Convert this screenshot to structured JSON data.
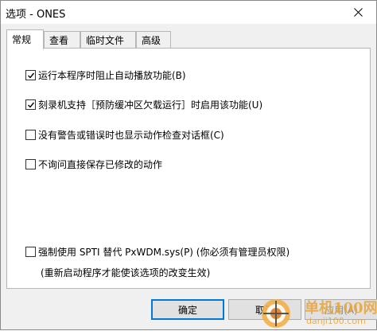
{
  "window": {
    "title": "选项 - ONES"
  },
  "tabs": [
    {
      "label": "常规",
      "active": true
    },
    {
      "label": "查看",
      "active": false
    },
    {
      "label": "临时文件",
      "active": false
    },
    {
      "label": "高级",
      "active": false
    }
  ],
  "options": [
    {
      "label": "运行本程序时阻止自动播放功能(B)",
      "checked": true
    },
    {
      "label": "刻录机支持［预防缓冲区欠载运行］时启用该功能(U)",
      "checked": true
    },
    {
      "label": "没有警告或错误时也显示动作检查对话框(C)",
      "checked": false
    },
    {
      "label": "不询问直接保存已修改的动作",
      "checked": false
    },
    {
      "label": "强制使用 SPTI 替代 PxWDM.sys(P) (你必须有管理员权限)",
      "checked": false
    }
  ],
  "note": "(重新启动程序才能使该选项的改变生效)",
  "buttons": {
    "ok": "确定",
    "cancel": "取消",
    "apply": "应用(A)"
  },
  "watermark": {
    "text": "单机100网",
    "url": "danji100.com"
  },
  "colors": {
    "accent": "#0078d7",
    "watermark": "#e8a33a"
  }
}
